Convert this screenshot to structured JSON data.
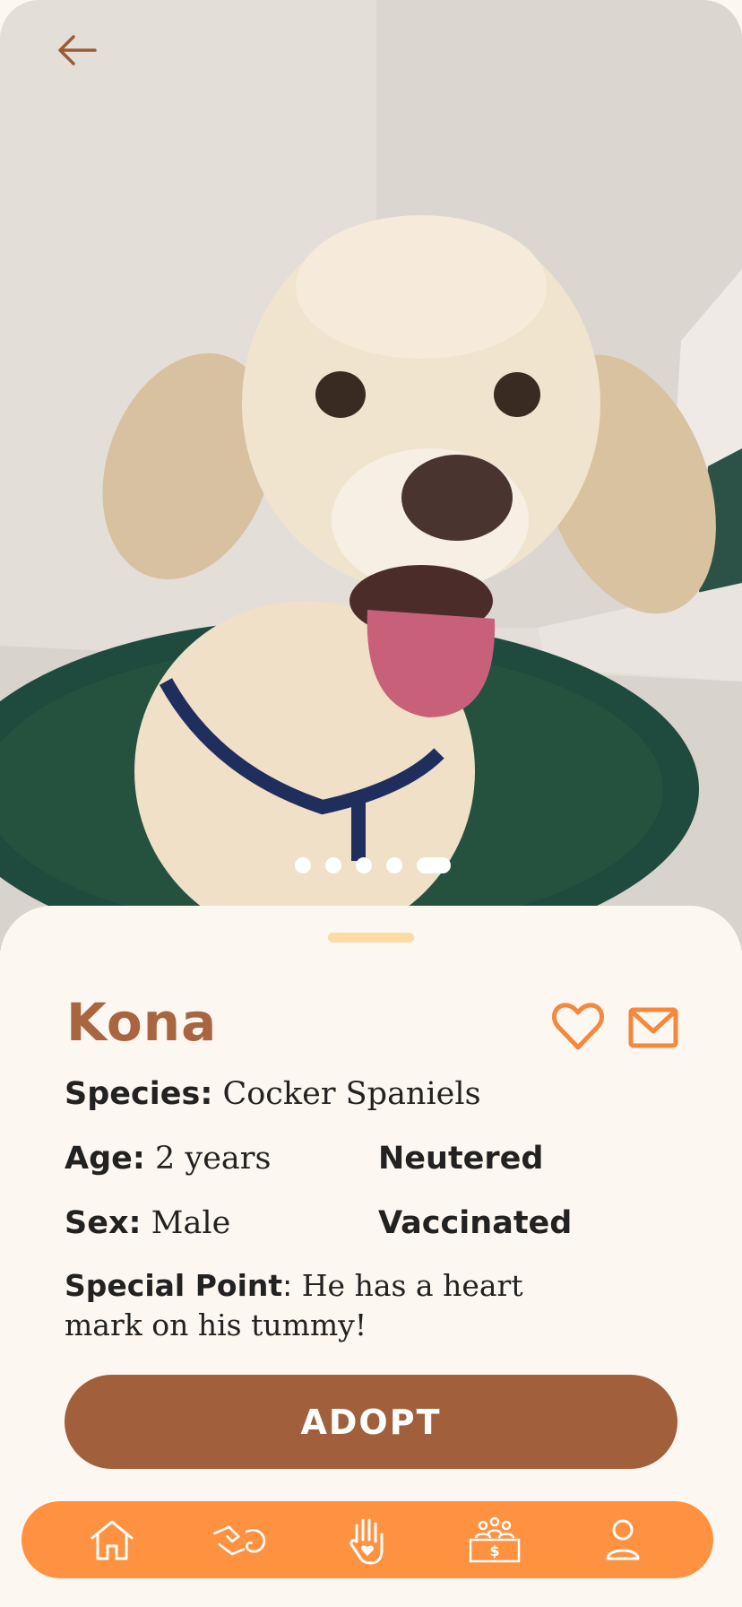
{
  "pet": {
    "name": "Kona",
    "species_label": "Species:",
    "species": "Cocker Spaniels",
    "age_label": "Age:",
    "age": "2 years",
    "sex_label": "Sex:",
    "sex": "Male",
    "status_1": "Neutered",
    "status_2": "Vaccinated",
    "special_label": "Special Point",
    "special_sep": ":",
    "special_text": "He has a heart mark on his tummy!"
  },
  "gallery": {
    "photo_count": 5,
    "active_index": 4
  },
  "actions": {
    "adopt_label": "ADOPT"
  },
  "nav": {
    "items": [
      "home-icon",
      "pet-hand-icon",
      "volunteer-hand-icon",
      "donation-icon",
      "profile-icon"
    ]
  },
  "colors": {
    "accent": "#ff9241",
    "brand_brown": "#a15f3b",
    "name_color": "#a96440",
    "background": "#fdf7f1"
  }
}
